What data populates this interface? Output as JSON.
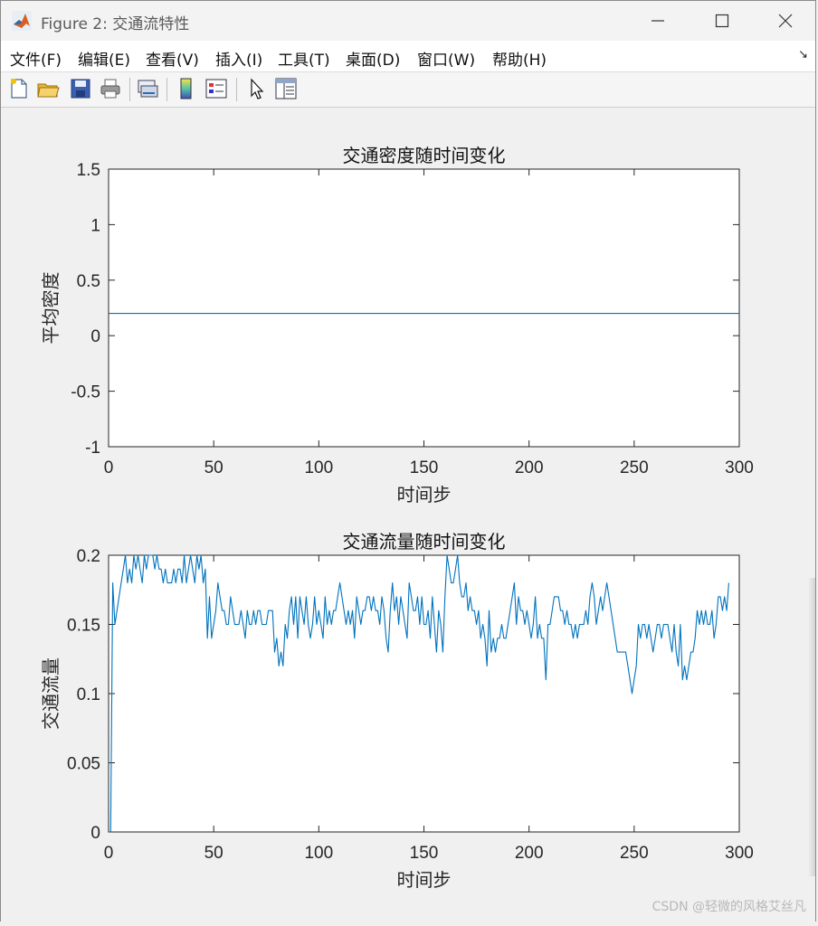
{
  "window": {
    "title": "Figure 2: 交通流特性",
    "app_icon": "matlab-logo-icon"
  },
  "menu": {
    "items": [
      "文件(F)",
      "编辑(E)",
      "查看(V)",
      "插入(I)",
      "工具(T)",
      "桌面(D)",
      "窗口(W)",
      "帮助(H)"
    ],
    "overflow_arrow": "↘"
  },
  "toolbar": {
    "buttons": [
      "new-figure-icon",
      "open-file-icon",
      "save-icon",
      "print-icon",
      "link-plot-icon",
      "insert-colorbar-icon",
      "insert-legend-icon",
      "edit-plot-pointer-icon",
      "property-inspector-icon"
    ]
  },
  "watermark": "CSDN @轻微的风格艾丝凡",
  "colors": {
    "line": "#0072bd",
    "axes_bg": "#ffffff",
    "figure_bg": "#f0f0f0"
  },
  "chart_data": [
    {
      "type": "line",
      "title": "交通密度随时间变化",
      "xlabel": "时间步",
      "ylabel": "平均密度",
      "xlim": [
        0,
        300
      ],
      "ylim": [
        -1,
        1.5
      ],
      "xticks": [
        "0",
        "50",
        "100",
        "150",
        "200",
        "250",
        "300"
      ],
      "yticks": [
        "-1",
        "-0.5",
        "0",
        "0.5",
        "1",
        "1.5"
      ],
      "grid": false,
      "series": [
        {
          "x": [
            0,
            300
          ],
          "y": [
            0.2,
            0.2
          ]
        }
      ]
    },
    {
      "type": "line",
      "title": "交通流量随时间变化",
      "xlabel": "时间步",
      "ylabel": "交通流量",
      "xlim": [
        0,
        300
      ],
      "ylim": [
        0,
        0.2
      ],
      "xticks": [
        "0",
        "50",
        "100",
        "150",
        "200",
        "250",
        "300"
      ],
      "yticks": [
        "0",
        "0.05",
        "0.1",
        "0.15",
        "0.2"
      ],
      "grid": false,
      "series": [
        {
          "x_start": 1,
          "y": [
            0.0,
            0.18,
            0.15,
            0.16,
            0.17,
            0.18,
            0.19,
            0.2,
            0.18,
            0.19,
            0.18,
            0.2,
            0.19,
            0.2,
            0.19,
            0.18,
            0.2,
            0.19,
            0.2,
            0.2,
            0.2,
            0.19,
            0.2,
            0.19,
            0.19,
            0.18,
            0.19,
            0.18,
            0.18,
            0.18,
            0.19,
            0.18,
            0.19,
            0.19,
            0.18,
            0.2,
            0.18,
            0.19,
            0.2,
            0.19,
            0.18,
            0.2,
            0.19,
            0.2,
            0.18,
            0.19,
            0.14,
            0.17,
            0.14,
            0.15,
            0.16,
            0.18,
            0.17,
            0.16,
            0.16,
            0.15,
            0.15,
            0.17,
            0.16,
            0.15,
            0.15,
            0.15,
            0.16,
            0.15,
            0.14,
            0.16,
            0.15,
            0.15,
            0.16,
            0.15,
            0.16,
            0.16,
            0.15,
            0.15,
            0.15,
            0.16,
            0.16,
            0.16,
            0.13,
            0.14,
            0.12,
            0.13,
            0.12,
            0.15,
            0.14,
            0.16,
            0.17,
            0.15,
            0.17,
            0.14,
            0.17,
            0.16,
            0.15,
            0.17,
            0.15,
            0.14,
            0.15,
            0.17,
            0.15,
            0.16,
            0.15,
            0.14,
            0.17,
            0.15,
            0.16,
            0.15,
            0.16,
            0.16,
            0.17,
            0.18,
            0.17,
            0.16,
            0.15,
            0.16,
            0.15,
            0.16,
            0.14,
            0.17,
            0.16,
            0.15,
            0.16,
            0.16,
            0.17,
            0.17,
            0.16,
            0.17,
            0.16,
            0.16,
            0.15,
            0.17,
            0.16,
            0.14,
            0.13,
            0.16,
            0.18,
            0.16,
            0.17,
            0.15,
            0.17,
            0.16,
            0.15,
            0.14,
            0.18,
            0.17,
            0.16,
            0.16,
            0.17,
            0.15,
            0.17,
            0.15,
            0.15,
            0.16,
            0.14,
            0.17,
            0.15,
            0.13,
            0.16,
            0.15,
            0.13,
            0.17,
            0.2,
            0.19,
            0.18,
            0.18,
            0.19,
            0.2,
            0.18,
            0.17,
            0.17,
            0.18,
            0.16,
            0.17,
            0.16,
            0.16,
            0.15,
            0.16,
            0.14,
            0.15,
            0.14,
            0.12,
            0.16,
            0.13,
            0.14,
            0.13,
            0.14,
            0.14,
            0.15,
            0.14,
            0.14,
            0.15,
            0.16,
            0.17,
            0.18,
            0.15,
            0.17,
            0.16,
            0.16,
            0.15,
            0.16,
            0.15,
            0.14,
            0.15,
            0.17,
            0.14,
            0.15,
            0.14,
            0.14,
            0.11,
            0.15,
            0.15,
            0.16,
            0.17,
            0.17,
            0.17,
            0.16,
            0.16,
            0.15,
            0.16,
            0.15,
            0.15,
            0.14,
            0.15,
            0.14,
            0.15,
            0.15,
            0.15,
            0.16,
            0.15,
            0.17,
            0.18,
            0.17,
            0.15,
            0.16,
            0.17,
            0.16,
            0.17,
            0.18,
            0.17,
            0.16,
            0.15,
            0.14,
            0.13,
            0.13,
            0.13,
            0.13,
            0.13,
            0.12,
            0.11,
            0.1,
            0.11,
            0.12,
            0.15,
            0.14,
            0.15,
            0.15,
            0.14,
            0.15,
            0.14,
            0.13,
            0.14,
            0.15,
            0.15,
            0.14,
            0.15,
            0.15,
            0.15,
            0.14,
            0.13,
            0.15,
            0.13,
            0.12,
            0.15,
            0.11,
            0.12,
            0.11,
            0.12,
            0.13,
            0.13,
            0.14,
            0.16,
            0.15,
            0.16,
            0.15,
            0.16,
            0.15,
            0.15,
            0.16,
            0.14,
            0.15,
            0.17,
            0.17,
            0.16,
            0.17,
            0.16,
            0.18
          ]
        }
      ]
    }
  ]
}
